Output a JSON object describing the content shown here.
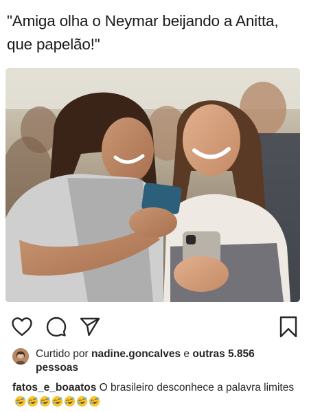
{
  "meme": {
    "caption_line1": "\"Amiga olha o Neymar beijando a Anitta,",
    "caption_line2": "que papelão!\""
  },
  "post": {
    "photo_icon": "people-photo",
    "tag_icon": "person-icon"
  },
  "actions": {
    "like_icon": "heart-icon",
    "comment_icon": "comment-icon",
    "share_icon": "send-icon",
    "save_icon": "bookmark-icon"
  },
  "likes": {
    "prefix": "Curtido por",
    "liker": "nadine.goncalves",
    "joiner": "e",
    "others": "outras 5.856",
    "others_unit": "pessoas"
  },
  "caption": {
    "username": "fatos_e_boaatos",
    "text": "O brasileiro desconhece a palavra limites",
    "emoji_name": "rolling-on-floor-laughing-emoji",
    "emoji_count": 7
  },
  "colors": {
    "text": "#262626",
    "icon": "#262626",
    "background": "#ffffff"
  }
}
